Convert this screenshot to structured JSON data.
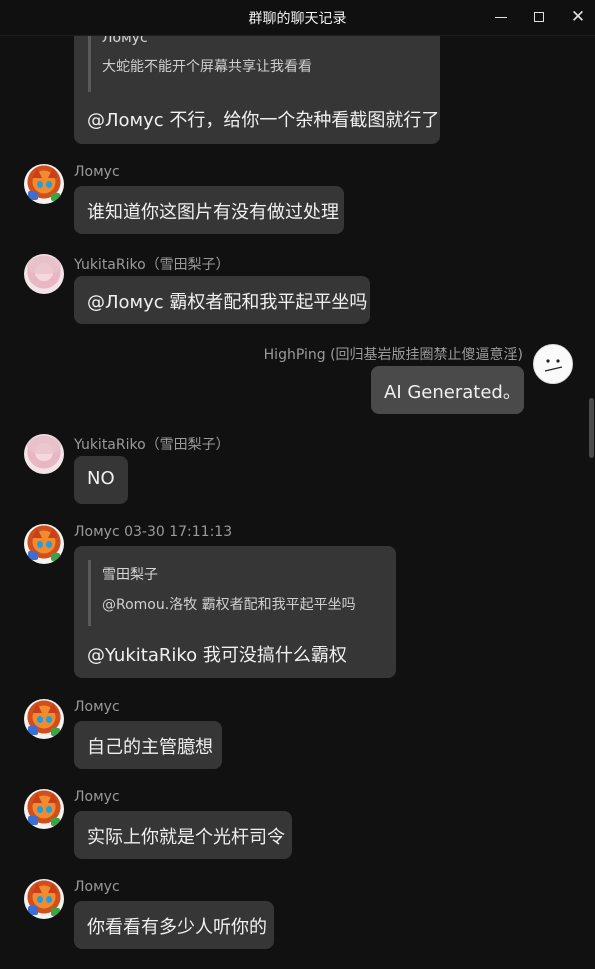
{
  "window": {
    "title": "群聊的聊天记录",
    "minimize_icon": "minimize-icon",
    "maximize_icon": "maximize-icon",
    "close_glyph": "✕"
  },
  "messages": [
    {
      "sender": "",
      "quote_name": "Ломус",
      "quote_text": "大蛇能不能开个屏幕共享让我看看",
      "text": "@Ломус 不行，给你一个杂种看截图就行了"
    },
    {
      "sender": "Ломус",
      "text": "谁知道你这图片有没有做过处理"
    },
    {
      "sender": "YukitaRiko（雪田梨子）",
      "text": "@Ломус 霸权者配和我平起平坐吗"
    },
    {
      "sender": "HighPing (回归基岩版挂圈禁止傻逼意淫)",
      "text": "AI Generated。"
    },
    {
      "sender": "YukitaRiko（雪田梨子）",
      "text": "NO"
    },
    {
      "sender": "Ломус 03-30 17:11:13",
      "quote_name": "雪田梨子",
      "quote_text": "@Romou.洛牧 霸权者配和我平起平坐吗",
      "text": "@YukitaRiko 我可没搞什么霸权"
    },
    {
      "sender": "Ломус",
      "text": "自己的主管臆想"
    },
    {
      "sender": "Ломус",
      "text": "实际上你就是个光杆司令"
    },
    {
      "sender": "Ломус",
      "text": "你看看有多少人听你的"
    }
  ]
}
